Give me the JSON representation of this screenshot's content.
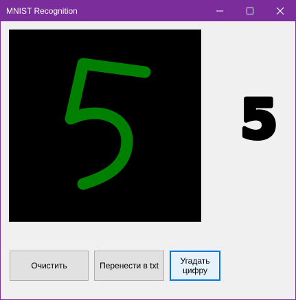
{
  "window": {
    "title": "MNIST Recognition",
    "accent_color": "#7a2d9b",
    "controls": {
      "minimize_icon": "minimize-icon",
      "maximize_icon": "maximize-icon",
      "close_icon": "close-icon"
    }
  },
  "canvas": {
    "background_color": "#000000",
    "stroke_color": "#008000",
    "drawn_digit": "5"
  },
  "prediction": {
    "digit": "5",
    "color": "#000000"
  },
  "buttons": {
    "clear_label": "Очистить",
    "export_label": "Перенести в txt",
    "guess_label": "Угадать цифру"
  }
}
